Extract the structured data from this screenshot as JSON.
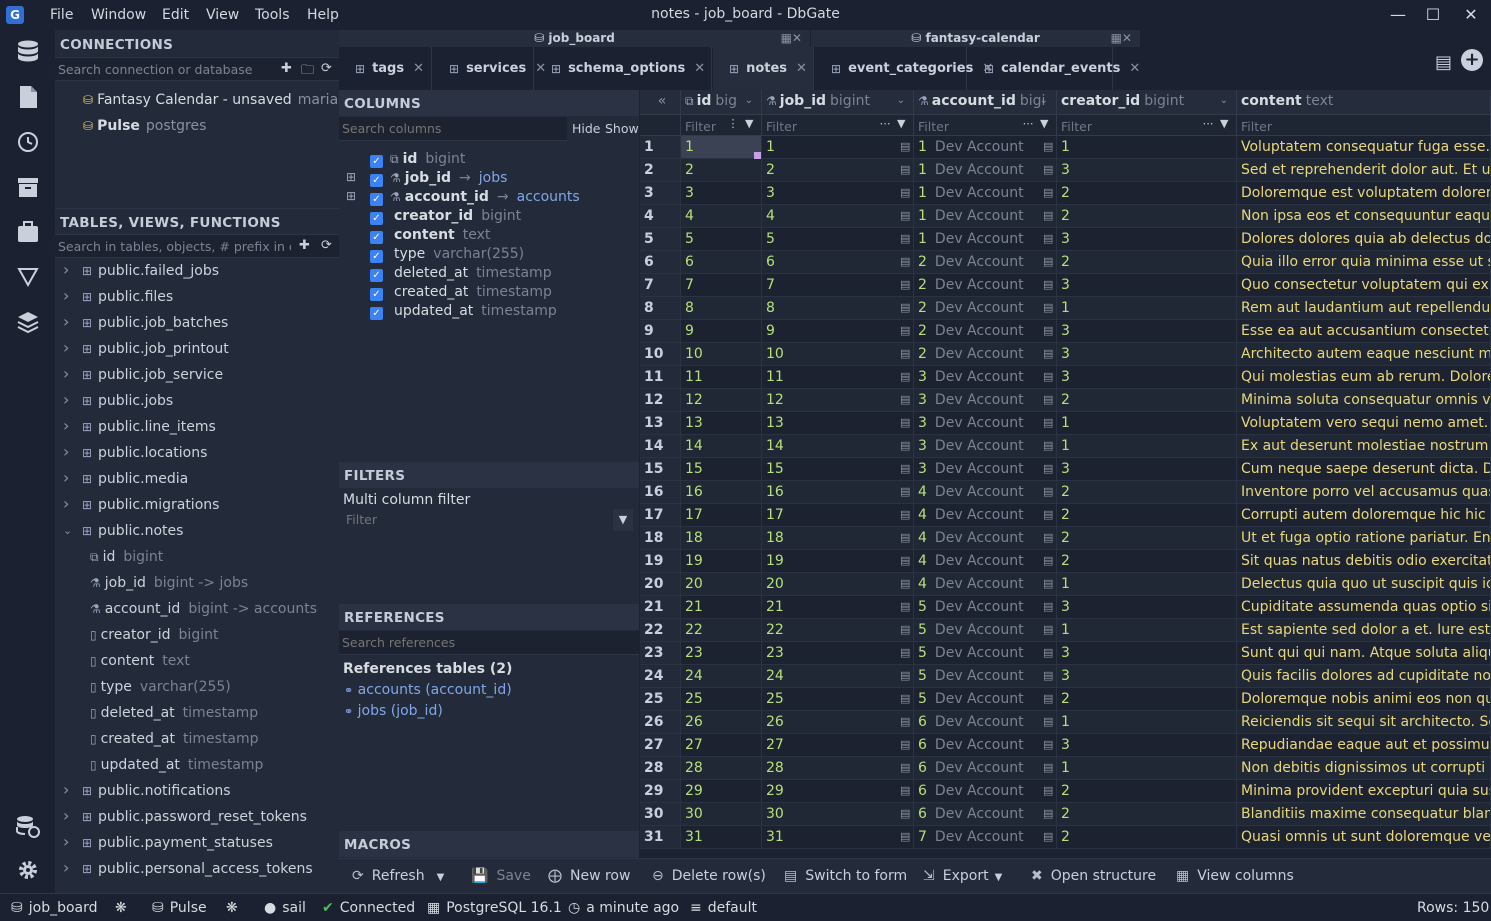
{
  "window": {
    "title": "notes - job_board - DbGate",
    "menu": [
      "File",
      "Window",
      "Edit",
      "View",
      "Tools",
      "Help"
    ],
    "logo": "G"
  },
  "connections": {
    "header": "CONNECTIONS",
    "search_placeholder": "Search connection or database",
    "items": [
      {
        "name": "Fantasy Calendar - unsaved",
        "engine": "mariadb"
      },
      {
        "name": "Pulse",
        "engine": "postgres"
      }
    ]
  },
  "tables": {
    "header": "TABLES, VIEWS, FUNCTIONS",
    "search_placeholder": "Search in tables, objects, # prefix in col",
    "items": [
      "public.failed_jobs",
      "public.files",
      "public.job_batches",
      "public.job_printout",
      "public.job_service",
      "public.jobs",
      "public.line_items",
      "public.locations",
      "public.media",
      "public.migrations",
      "public.notes"
    ],
    "notes_columns": [
      {
        "name": "id",
        "type": "bigint"
      },
      {
        "name": "job_id",
        "type": "bigint -> jobs"
      },
      {
        "name": "account_id",
        "type": "bigint -> accounts"
      },
      {
        "name": "creator_id",
        "type": "bigint"
      },
      {
        "name": "content",
        "type": "text"
      },
      {
        "name": "type",
        "type": "varchar(255)"
      },
      {
        "name": "deleted_at",
        "type": "timestamp"
      },
      {
        "name": "created_at",
        "type": "timestamp"
      },
      {
        "name": "updated_at",
        "type": "timestamp"
      }
    ],
    "items_after": [
      "public.notifications",
      "public.password_reset_tokens",
      "public.payment_statuses",
      "public.personal_access_tokens"
    ]
  },
  "tab_groups": [
    "job_board",
    "fantasy-calendar"
  ],
  "tabs": [
    "tags",
    "services",
    "schema_options",
    "notes",
    "event_categories",
    "calendar_events"
  ],
  "columns_panel": {
    "header": "COLUMNS",
    "search_placeholder": "Search columns",
    "hide_label": "Hide",
    "show_label": "Show",
    "items": [
      {
        "name": "id",
        "type": "bigint",
        "ref": ""
      },
      {
        "name": "job_id",
        "type": "",
        "ref": "jobs"
      },
      {
        "name": "account_id",
        "type": "",
        "ref": "accounts"
      },
      {
        "name": "creator_id",
        "type": "bigint",
        "ref": ""
      },
      {
        "name": "content",
        "type": "text",
        "ref": ""
      },
      {
        "name": "type",
        "type": "varchar(255)",
        "ref": ""
      },
      {
        "name": "deleted_at",
        "type": "timestamp",
        "ref": ""
      },
      {
        "name": "created_at",
        "type": "timestamp",
        "ref": ""
      },
      {
        "name": "updated_at",
        "type": "timestamp",
        "ref": ""
      }
    ]
  },
  "filters_panel": {
    "header": "FILTERS",
    "label": "Multi column filter",
    "placeholder": "Filter"
  },
  "references_panel": {
    "header": "REFERENCES",
    "search_placeholder": "Search references",
    "title": "References tables (2)",
    "items": [
      "accounts (account_id)",
      "jobs (job_id)"
    ]
  },
  "macros_panel": {
    "header": "MACROS"
  },
  "grid": {
    "headers": [
      {
        "name": "id",
        "type": "big"
      },
      {
        "name": "job_id",
        "type": "bigint"
      },
      {
        "name": "account_id",
        "type": "bigi"
      },
      {
        "name": "creator_id",
        "type": "bigint"
      },
      {
        "name": "content",
        "type": "text"
      }
    ],
    "filter_placeholder": "Filter",
    "account_label": "Dev Account",
    "rows": [
      [
        1,
        1,
        1,
        1,
        "Voluptatem consequatur fuga esse. Qu"
      ],
      [
        2,
        2,
        1,
        3,
        "Sed et reprehenderit dolor aut. Et ut e"
      ],
      [
        3,
        3,
        1,
        2,
        "Doloremque est voluptatem dolorem."
      ],
      [
        4,
        4,
        1,
        2,
        "Non ipsa eos et consequuntur eaque v"
      ],
      [
        5,
        5,
        1,
        3,
        "Dolores dolores quia ab delectus dolo"
      ],
      [
        6,
        6,
        2,
        2,
        "Quia illo error quia minima esse ut sap"
      ],
      [
        7,
        7,
        2,
        3,
        "Quo consectetur voluptatem qui explic"
      ],
      [
        8,
        8,
        2,
        1,
        "Rem aut laudantium aut repellendus r"
      ],
      [
        9,
        9,
        2,
        3,
        "Esse ea aut accusantium consectetur a"
      ],
      [
        10,
        10,
        2,
        3,
        "Architecto autem eaque nesciunt minu"
      ],
      [
        11,
        11,
        3,
        3,
        "Qui molestias eum ab rerum. Dolore e"
      ],
      [
        12,
        12,
        3,
        2,
        "Minima soluta consequatur omnis volu"
      ],
      [
        13,
        13,
        3,
        1,
        "Voluptatem vero sequi nemo amet. Ea"
      ],
      [
        14,
        14,
        3,
        1,
        "Ex aut deserunt molestiae nostrum ut"
      ],
      [
        15,
        15,
        3,
        3,
        "Cum neque saepe deserunt dicta. Dist"
      ],
      [
        16,
        16,
        4,
        2,
        "Inventore porro vel accusamus quas q"
      ],
      [
        17,
        17,
        4,
        2,
        "Corrupti autem doloremque hic hic illo"
      ],
      [
        18,
        18,
        4,
        2,
        "Ut et fuga optio ratione pariatur. Enim"
      ],
      [
        19,
        19,
        4,
        2,
        "Sit quas natus debitis odio exercitation"
      ],
      [
        20,
        20,
        4,
        1,
        "Delectus quia quo ut suscipit quis id re"
      ],
      [
        21,
        21,
        5,
        3,
        "Cupiditate assumenda quas optio sint"
      ],
      [
        22,
        22,
        5,
        1,
        "Est sapiente sed dolor a et. Iure est vo"
      ],
      [
        23,
        23,
        5,
        3,
        "Sunt qui qui nam. Atque soluta aliquid"
      ],
      [
        24,
        24,
        5,
        3,
        "Quis facilis dolores ad cupiditate non c"
      ],
      [
        25,
        25,
        5,
        2,
        "Doloremque nobis animi eos non quid"
      ],
      [
        26,
        26,
        6,
        1,
        "Reiciendis sit sequi sit architecto. Sed"
      ],
      [
        27,
        27,
        6,
        3,
        "Repudiandae eaque aut et possimus. S"
      ],
      [
        28,
        28,
        6,
        1,
        "Non debitis dignissimos ut corrupti ev"
      ],
      [
        29,
        29,
        6,
        2,
        "Minima provident excepturi quia susci"
      ],
      [
        30,
        30,
        6,
        2,
        "Blanditiis maxime consequatur blandit"
      ],
      [
        31,
        31,
        7,
        2,
        "Quasi omnis ut sunt doloremque verit"
      ]
    ]
  },
  "toolbar": {
    "refresh": "Refresh",
    "save": "Save",
    "new_row": "New row",
    "delete_rows": "Delete row(s)",
    "switch_form": "Switch to form",
    "export": "Export",
    "open_structure": "Open structure",
    "view_columns": "View columns"
  },
  "statusbar": {
    "db": "job_board",
    "conn": "Pulse",
    "user": "sail",
    "status": "Connected",
    "engine": "PostgreSQL 16.1",
    "time": "a minute ago",
    "schema": "default",
    "rows": "Rows: 150"
  },
  "colors": {
    "accent": "#3b82f6",
    "number": "#b7e07a",
    "text": "#e8d77a",
    "connected": "#4cc15a"
  }
}
